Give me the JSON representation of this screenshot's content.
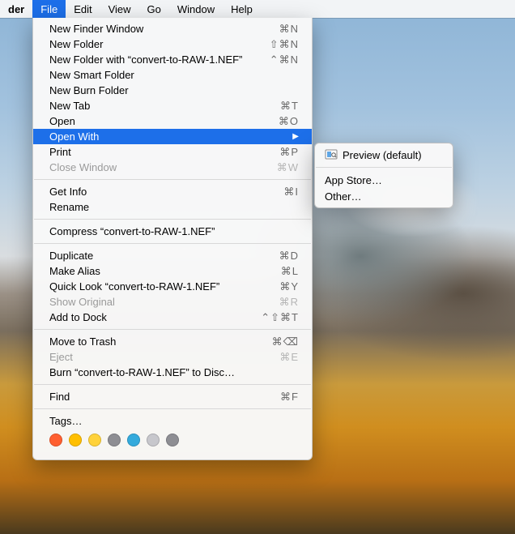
{
  "menubar": {
    "app": "der",
    "items": [
      "File",
      "Edit",
      "View",
      "Go",
      "Window",
      "Help"
    ],
    "active_index": 0
  },
  "file_menu": {
    "groups": [
      [
        {
          "label": "New Finder Window",
          "shortcut": "⌘N"
        },
        {
          "label": "New Folder",
          "shortcut": "⇧⌘N"
        },
        {
          "label": "New Folder with “convert-to-RAW-1.NEF”",
          "shortcut": "⌃⌘N"
        },
        {
          "label": "New Smart Folder",
          "shortcut": ""
        },
        {
          "label": "New Burn Folder",
          "shortcut": ""
        },
        {
          "label": "New Tab",
          "shortcut": "⌘T"
        },
        {
          "label": "Open",
          "shortcut": "⌘O"
        },
        {
          "label": "Open With",
          "shortcut": "",
          "submenu": true,
          "highlight": true
        },
        {
          "label": "Print",
          "shortcut": "⌘P"
        },
        {
          "label": "Close Window",
          "shortcut": "⌘W",
          "disabled": true
        }
      ],
      [
        {
          "label": "Get Info",
          "shortcut": "⌘I"
        },
        {
          "label": "Rename",
          "shortcut": ""
        }
      ],
      [
        {
          "label": "Compress “convert-to-RAW-1.NEF”",
          "shortcut": ""
        }
      ],
      [
        {
          "label": "Duplicate",
          "shortcut": "⌘D"
        },
        {
          "label": "Make Alias",
          "shortcut": "⌘L"
        },
        {
          "label": "Quick Look “convert-to-RAW-1.NEF”",
          "shortcut": "⌘Y"
        },
        {
          "label": "Show Original",
          "shortcut": "⌘R",
          "disabled": true
        },
        {
          "label": "Add to Dock",
          "shortcut": "⌃⇧⌘T"
        }
      ],
      [
        {
          "label": "Move to Trash",
          "shortcut": "⌘⌫"
        },
        {
          "label": "Eject",
          "shortcut": "⌘E",
          "disabled": true
        },
        {
          "label": "Burn “convert-to-RAW-1.NEF” to Disc…",
          "shortcut": ""
        }
      ],
      [
        {
          "label": "Find",
          "shortcut": "⌘F"
        }
      ],
      [
        {
          "label": "Tags…",
          "shortcut": ""
        }
      ]
    ],
    "tag_colors": [
      "#ff5f30",
      "#ffbf00",
      "#ffd23a",
      "#8e8e93",
      "#34aadc",
      "#c7c7cc",
      "#8e8e93"
    ]
  },
  "open_with_submenu": {
    "items": [
      {
        "label": "Preview (default)",
        "icon": "preview-icon"
      },
      {
        "separator": true
      },
      {
        "label": "App Store…"
      },
      {
        "label": "Other…"
      }
    ]
  }
}
